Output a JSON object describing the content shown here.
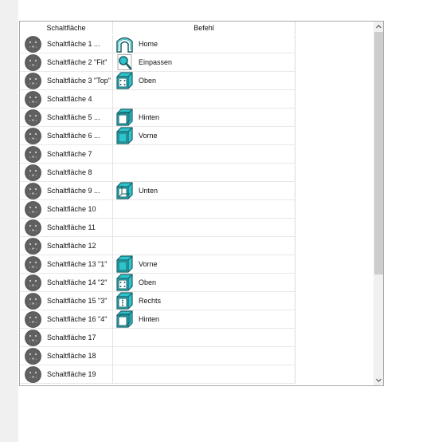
{
  "header": {
    "col_button": "Schaltfläche",
    "col_command": "Befehl"
  },
  "rows": [
    {
      "button": "Schaltfläche 1 ...",
      "command": "Home",
      "icon": "home-icon"
    },
    {
      "button": "Schaltfläche 2 \"Fit\"",
      "command": "Einpassen",
      "icon": "fit-zoom-icon"
    },
    {
      "button": "Schaltfläche 3 \"Top\"",
      "command": "Oben",
      "icon": "cube-top-view-icon"
    },
    {
      "button": "Schaltfläche 4",
      "command": "",
      "icon": ""
    },
    {
      "button": "Schaltfläche 5 ...",
      "command": "Hinten",
      "icon": "cube-back-view-icon"
    },
    {
      "button": "Schaltfläche 6 ...",
      "command": "Vorne",
      "icon": "cube-front-view-icon"
    },
    {
      "button": "Schaltfläche 7",
      "command": "",
      "icon": ""
    },
    {
      "button": "Schaltfläche 8",
      "command": "",
      "icon": ""
    },
    {
      "button": "Schaltfläche 9 ...",
      "command": "Unten",
      "icon": "cube-bottom-view-icon"
    },
    {
      "button": "Schaltfläche 10",
      "command": "",
      "icon": ""
    },
    {
      "button": "Schaltfläche 11",
      "command": "",
      "icon": ""
    },
    {
      "button": "Schaltfläche 12",
      "command": "",
      "icon": ""
    },
    {
      "button": "Schaltfläche 13 \"1\"",
      "command": "Vorne",
      "icon": "cube-front-view-icon"
    },
    {
      "button": "Schaltfläche 14 \"2\"",
      "command": "Oben",
      "icon": "cube-top-view-icon"
    },
    {
      "button": "Schaltfläche 15 \"3\"",
      "command": "Rechts",
      "icon": "cube-right-view-icon"
    },
    {
      "button": "Schaltfläche 16 \"4\"",
      "command": "Hinten",
      "icon": "cube-back-view-icon"
    },
    {
      "button": "Schaltfläche 17",
      "command": "",
      "icon": ""
    },
    {
      "button": "Schaltfläche 18",
      "command": "",
      "icon": ""
    },
    {
      "button": "Schaltfläche 19",
      "command": "",
      "icon": ""
    }
  ],
  "colors": {
    "icon_teal": "#2ec4cc",
    "icon_outline": "#1b5f66",
    "button_icon": "#606060",
    "scroll_thumb": "#cdcdcd"
  }
}
